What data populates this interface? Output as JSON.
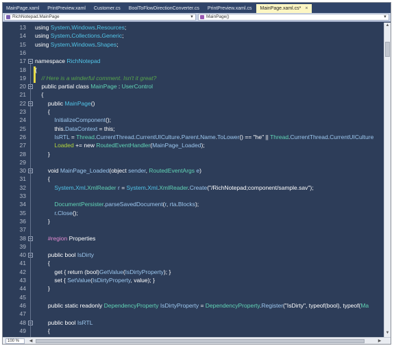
{
  "tabs": [
    {
      "label": "MainPage.xaml",
      "active": false
    },
    {
      "label": "PrintPreview.xaml",
      "active": false
    },
    {
      "label": "Customer.cs",
      "active": false
    },
    {
      "label": "BoolToFlowDirectionConverter.cs",
      "active": false
    },
    {
      "label": "PrintPreview.xaml.cs",
      "active": false
    },
    {
      "label": "MainPage.xaml.cs*",
      "active": true
    }
  ],
  "nav": {
    "class_combo": "RichNotepad.MainPage",
    "member_combo": "MainPage()"
  },
  "zoom": "100 %",
  "lines": [
    {
      "n": "13",
      "tokens": [
        [
          "kw",
          "using "
        ],
        [
          "type",
          "System"
        ],
        [
          "kw",
          "."
        ],
        [
          "type",
          "Windows"
        ],
        [
          "kw",
          "."
        ],
        [
          "type",
          "Resources"
        ],
        [
          "kw",
          ";"
        ]
      ]
    },
    {
      "n": "14",
      "tokens": [
        [
          "kw",
          "using "
        ],
        [
          "type",
          "System"
        ],
        [
          "kw",
          "."
        ],
        [
          "type",
          "Collections"
        ],
        [
          "kw",
          "."
        ],
        [
          "type",
          "Generic"
        ],
        [
          "kw",
          ";"
        ]
      ]
    },
    {
      "n": "15",
      "tokens": [
        [
          "kw",
          "using "
        ],
        [
          "type",
          "System"
        ],
        [
          "kw",
          "."
        ],
        [
          "type",
          "Windows"
        ],
        [
          "kw",
          "."
        ],
        [
          "type",
          "Shapes"
        ],
        [
          "kw",
          ";"
        ]
      ]
    },
    {
      "n": "16",
      "tokens": []
    },
    {
      "n": "17",
      "tokens": [
        [
          "kw",
          "namespace "
        ],
        [
          "type",
          "RichNotepad"
        ]
      ]
    },
    {
      "n": "18",
      "tokens": [
        [
          "kw",
          "{"
        ]
      ]
    },
    {
      "n": "19",
      "tokens": [
        [
          "kw",
          "    "
        ],
        [
          "cm",
          "// Here is a winderful comment. Isn't it great?"
        ]
      ]
    },
    {
      "n": "20",
      "tokens": [
        [
          "kw",
          "    public partial class "
        ],
        [
          "cls",
          "MainPage"
        ],
        [
          "kw",
          " : "
        ],
        [
          "cls",
          "UserControl"
        ]
      ]
    },
    {
      "n": "21",
      "tokens": [
        [
          "kw",
          "    {"
        ]
      ]
    },
    {
      "n": "22",
      "tokens": [
        [
          "kw",
          "        public "
        ],
        [
          "type",
          "MainPage"
        ],
        [
          "kw",
          "()"
        ]
      ]
    },
    {
      "n": "23",
      "tokens": [
        [
          "kw",
          "        {"
        ]
      ]
    },
    {
      "n": "24",
      "tokens": [
        [
          "kw",
          "            "
        ],
        [
          "mem",
          "InitializeComponent"
        ],
        [
          "kw",
          "();"
        ]
      ]
    },
    {
      "n": "25",
      "tokens": [
        [
          "kw",
          "            this."
        ],
        [
          "mem",
          "DataContext"
        ],
        [
          "kw",
          " = this;"
        ]
      ]
    },
    {
      "n": "26",
      "tokens": [
        [
          "kw",
          "            "
        ],
        [
          "mem",
          "IsRTL"
        ],
        [
          "kw",
          " = "
        ],
        [
          "cls",
          "Thread"
        ],
        [
          "kw",
          "."
        ],
        [
          "mem",
          "CurrentThread"
        ],
        [
          "kw",
          "."
        ],
        [
          "mem",
          "CurrentUICulture"
        ],
        [
          "kw",
          "."
        ],
        [
          "mem",
          "Parent"
        ],
        [
          "kw",
          "."
        ],
        [
          "mem",
          "Name"
        ],
        [
          "kw",
          "."
        ],
        [
          "mem",
          "ToLower"
        ],
        [
          "kw",
          "() == \"he\" || "
        ],
        [
          "cls",
          "Thread"
        ],
        [
          "kw",
          "."
        ],
        [
          "mem",
          "CurrentThread"
        ],
        [
          "kw",
          "."
        ],
        [
          "mem",
          "CurrentUICulture"
        ]
      ]
    },
    {
      "n": "27",
      "tokens": [
        [
          "kw",
          "            "
        ],
        [
          "ev",
          "Loaded"
        ],
        [
          "kw",
          " += new "
        ],
        [
          "cls",
          "RoutedEventHandler"
        ],
        [
          "kw",
          "("
        ],
        [
          "mem",
          "MainPage_Loaded"
        ],
        [
          "kw",
          ");"
        ]
      ]
    },
    {
      "n": "28",
      "tokens": [
        [
          "kw",
          "        }"
        ]
      ]
    },
    {
      "n": "29",
      "tokens": []
    },
    {
      "n": "30",
      "tokens": [
        [
          "kw",
          "        void "
        ],
        [
          "mem",
          "MainPage_Loaded"
        ],
        [
          "kw",
          "(object "
        ],
        [
          "mem",
          "sender"
        ],
        [
          "kw",
          ", "
        ],
        [
          "cls",
          "RoutedEventArgs"
        ],
        [
          "kw",
          " "
        ],
        [
          "mem",
          "e"
        ],
        [
          "kw",
          ")"
        ]
      ]
    },
    {
      "n": "31",
      "tokens": [
        [
          "kw",
          "        {"
        ]
      ]
    },
    {
      "n": "32",
      "tokens": [
        [
          "kw",
          "            "
        ],
        [
          "type",
          "System"
        ],
        [
          "kw",
          "."
        ],
        [
          "type",
          "Xml"
        ],
        [
          "kw",
          "."
        ],
        [
          "cls",
          "XmlReader"
        ],
        [
          "kw",
          " "
        ],
        [
          "mem",
          "r"
        ],
        [
          "kw",
          " = "
        ],
        [
          "type",
          "System"
        ],
        [
          "kw",
          "."
        ],
        [
          "type",
          "Xml"
        ],
        [
          "kw",
          "."
        ],
        [
          "cls",
          "XmlReader"
        ],
        [
          "kw",
          "."
        ],
        [
          "mem",
          "Create"
        ],
        [
          "kw",
          "("
        ],
        [
          "str",
          "\"/RichNotepad;component/sample.sav\""
        ],
        [
          "kw",
          ");"
        ]
      ]
    },
    {
      "n": "33",
      "tokens": []
    },
    {
      "n": "34",
      "tokens": [
        [
          "kw",
          "            "
        ],
        [
          "cls",
          "DocumentPersister"
        ],
        [
          "kw",
          "."
        ],
        [
          "mem",
          "parseSavedDocument"
        ],
        [
          "kw",
          "("
        ],
        [
          "mem",
          "r"
        ],
        [
          "kw",
          ", "
        ],
        [
          "mem",
          "rta"
        ],
        [
          "kw",
          "."
        ],
        [
          "mem",
          "Blocks"
        ],
        [
          "kw",
          ");"
        ]
      ]
    },
    {
      "n": "35",
      "tokens": [
        [
          "kw",
          "            "
        ],
        [
          "mem",
          "r"
        ],
        [
          "kw",
          "."
        ],
        [
          "mem",
          "Close"
        ],
        [
          "kw",
          "();"
        ]
      ]
    },
    {
      "n": "36",
      "tokens": [
        [
          "kw",
          "        }"
        ]
      ]
    },
    {
      "n": "37",
      "tokens": []
    },
    {
      "n": "38",
      "tokens": [
        [
          "kw",
          "        "
        ],
        [
          "rg",
          "#region"
        ],
        [
          "kw",
          " Properties"
        ]
      ]
    },
    {
      "n": "39",
      "tokens": []
    },
    {
      "n": "40",
      "tokens": [
        [
          "kw",
          "        public bool "
        ],
        [
          "mem",
          "IsDirty"
        ]
      ]
    },
    {
      "n": "41",
      "tokens": [
        [
          "kw",
          "        {"
        ]
      ]
    },
    {
      "n": "42",
      "tokens": [
        [
          "kw",
          "            get { return (bool)"
        ],
        [
          "mem",
          "GetValue"
        ],
        [
          "kw",
          "("
        ],
        [
          "mem",
          "IsDirtyProperty"
        ],
        [
          "kw",
          "); }"
        ]
      ]
    },
    {
      "n": "43",
      "tokens": [
        [
          "kw",
          "            set { "
        ],
        [
          "mem",
          "SetValue"
        ],
        [
          "kw",
          "("
        ],
        [
          "mem",
          "IsDirtyProperty"
        ],
        [
          "kw",
          ", value); }"
        ]
      ]
    },
    {
      "n": "44",
      "tokens": [
        [
          "kw",
          "        }"
        ]
      ]
    },
    {
      "n": "45",
      "tokens": []
    },
    {
      "n": "46",
      "tokens": [
        [
          "kw",
          "        public static readonly "
        ],
        [
          "cls",
          "DependencyProperty"
        ],
        [
          "kw",
          " "
        ],
        [
          "mem",
          "IsDirtyProperty"
        ],
        [
          "kw",
          " = "
        ],
        [
          "cls",
          "DependencyProperty"
        ],
        [
          "kw",
          "."
        ],
        [
          "mem",
          "Register"
        ],
        [
          "kw",
          "("
        ],
        [
          "str",
          "\"IsDirty\""
        ],
        [
          "kw",
          ", typeof(bool), typeof("
        ],
        [
          "cls",
          "Ma"
        ]
      ]
    },
    {
      "n": "47",
      "tokens": []
    },
    {
      "n": "48",
      "tokens": [
        [
          "kw",
          "        public bool "
        ],
        [
          "mem",
          "IsRTL"
        ]
      ]
    },
    {
      "n": "49",
      "tokens": [
        [
          "kw",
          "        {"
        ]
      ]
    },
    {
      "n": "50",
      "tokens": [
        [
          "kw",
          "            get { return (bool)"
        ],
        [
          "mem",
          "GetValue"
        ],
        [
          "kw",
          "("
        ],
        [
          "mem",
          "IsRTLProperty"
        ],
        [
          "kw",
          "); }"
        ]
      ]
    }
  ]
}
